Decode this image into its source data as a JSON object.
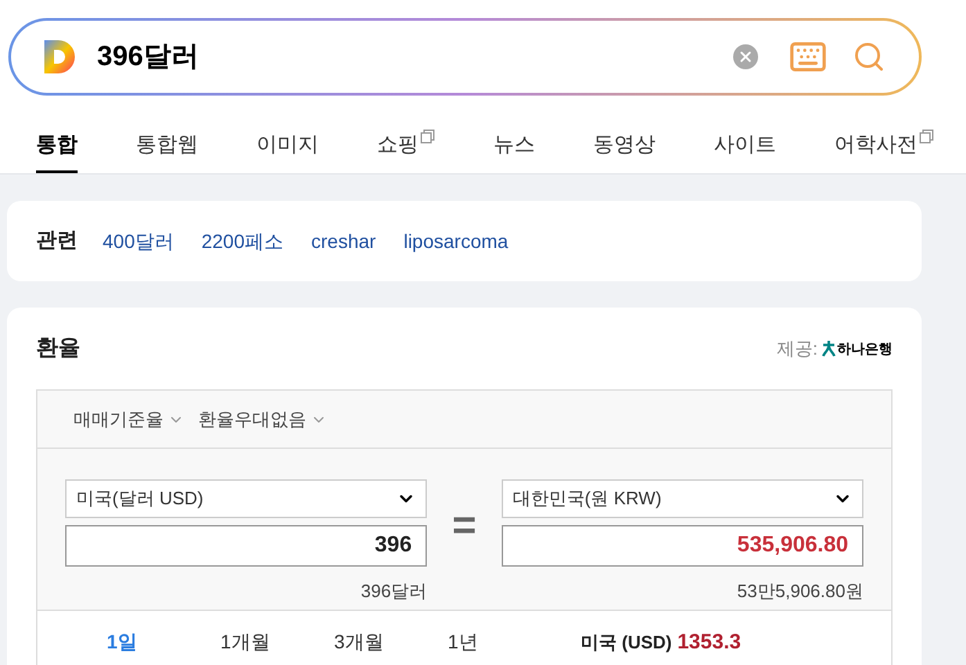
{
  "search": {
    "value": "396달러"
  },
  "tabs": [
    {
      "label": "통합",
      "selected": true,
      "external": false
    },
    {
      "label": "통합웹",
      "selected": false,
      "external": false
    },
    {
      "label": "이미지",
      "selected": false,
      "external": false
    },
    {
      "label": "쇼핑",
      "selected": false,
      "external": true
    },
    {
      "label": "뉴스",
      "selected": false,
      "external": false
    },
    {
      "label": "동영상",
      "selected": false,
      "external": false
    },
    {
      "label": "사이트",
      "selected": false,
      "external": false
    },
    {
      "label": "어학사전",
      "selected": false,
      "external": true
    }
  ],
  "related": {
    "title": "관련",
    "links": [
      "400달러",
      "2200페소",
      "creshar",
      "liposarcoma"
    ]
  },
  "exchange": {
    "title": "환율",
    "provider_label": "제공:",
    "provider_name": "하나은행",
    "options": [
      "매매기준율",
      "환율우대없음"
    ],
    "from": {
      "currency": "미국(달러 USD)",
      "amount": "396",
      "reading": "396달러"
    },
    "equals": "=",
    "to": {
      "currency": "대한민국(원 KRW)",
      "amount": "535,906.80",
      "reading": "53만5,906.80원"
    },
    "periods": [
      {
        "label": "1일",
        "selected": true
      },
      {
        "label": "1개월",
        "selected": false
      },
      {
        "label": "3개월",
        "selected": false
      },
      {
        "label": "1년",
        "selected": false
      }
    ],
    "rate_label": "미국 (USD)",
    "rate_value": "1353.3"
  }
}
